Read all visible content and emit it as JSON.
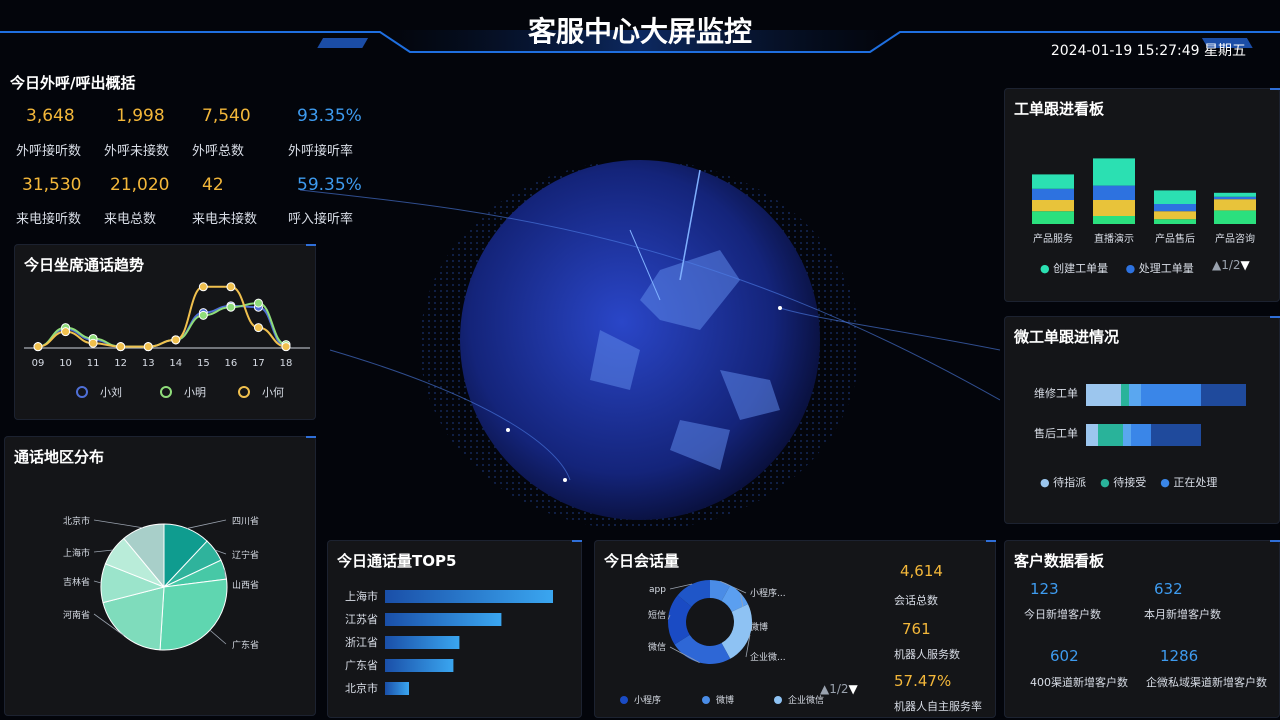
{
  "header": {
    "title": "客服中心大屏监控",
    "datetime": "2024-01-19 15:27:49 星期五"
  },
  "overview": {
    "title": "今日外呼/呼出概括",
    "stats": [
      {
        "value": "3,648",
        "label": "外呼接听数",
        "color": "#f3b73a"
      },
      {
        "value": "1,998",
        "label": "外呼未接数",
        "color": "#f3b73a"
      },
      {
        "value": "7,540",
        "label": "外呼总数",
        "color": "#f3b73a"
      },
      {
        "value": "93.35%",
        "label": "外呼接听率",
        "color": "#3e9bef"
      },
      {
        "value": "31,530",
        "label": "来电接听数",
        "color": "#f3b73a"
      },
      {
        "value": "21,020",
        "label": "来电总数",
        "color": "#f3b73a"
      },
      {
        "value": "42",
        "label": "来电未接数",
        "color": "#f3b73a"
      },
      {
        "value": "59.35%",
        "label": "呼入接听率",
        "color": "#3e9bef"
      }
    ]
  },
  "trend": {
    "title": "今日坐席通话趋势",
    "legend": [
      {
        "name": "小刘",
        "color": "#4f6fd6"
      },
      {
        "name": "小明",
        "color": "#8fdc7a"
      },
      {
        "name": "小何",
        "color": "#f0c04e"
      }
    ]
  },
  "region": {
    "title": "通话地区分布"
  },
  "top5": {
    "title": "今日通话量TOP5"
  },
  "sessions": {
    "title": "今日会话量",
    "pager": "1/2",
    "stats": [
      {
        "value": "4,614",
        "label": "会话总数"
      },
      {
        "value": "761",
        "label": "机器人服务数"
      },
      {
        "value": "57.47%",
        "label": "机器人自主服务率"
      }
    ]
  },
  "customers": {
    "title": "客户数据看板",
    "stats": [
      {
        "value": "123",
        "label": "今日新增客户数"
      },
      {
        "value": "632",
        "label": "本月新增客户数"
      },
      {
        "value": "602",
        "label": "400渠道新增客户数"
      },
      {
        "value": "1286",
        "label": "企微私域渠道新增客户数"
      }
    ]
  },
  "tickets": {
    "title": "工单跟进看板",
    "pager": "1/2",
    "legend": [
      {
        "name": "创建工单量",
        "color": "#2be0b2"
      },
      {
        "name": "处理工单量",
        "color": "#2d72e0"
      }
    ]
  },
  "micro": {
    "title": "微工单跟进情况",
    "legend": [
      {
        "name": "待指派",
        "color": "#9cc6ee"
      },
      {
        "name": "待接受",
        "color": "#29b39a"
      },
      {
        "name": "正在处理",
        "color": "#3a86e8"
      }
    ]
  },
  "chart_data": [
    {
      "type": "line",
      "id": "trend",
      "title": "今日坐席通话趋势",
      "x": [
        "09",
        "10",
        "11",
        "12",
        "13",
        "14",
        "15",
        "16",
        "17",
        "18"
      ],
      "ylim": [
        0,
        100
      ],
      "series": [
        {
          "name": "小刘",
          "color": "#4f6fd6",
          "values": [
            2,
            28,
            12,
            2,
            2,
            12,
            52,
            62,
            60,
            2
          ]
        },
        {
          "name": "小明",
          "color": "#8fdc7a",
          "values": [
            2,
            30,
            14,
            2,
            2,
            12,
            48,
            60,
            66,
            5
          ]
        },
        {
          "name": "小何",
          "color": "#f0c04e",
          "values": [
            2,
            24,
            7,
            2,
            2,
            12,
            90,
            90,
            30,
            2
          ]
        }
      ]
    },
    {
      "type": "pie",
      "id": "region",
      "title": "通话地区分布",
      "slices": [
        {
          "label": "四川省",
          "value": 12,
          "color": "#0f9c8f"
        },
        {
          "label": "辽宁省",
          "value": 6,
          "color": "#2fb39c"
        },
        {
          "label": "山西省",
          "value": 5,
          "color": "#47c8a6"
        },
        {
          "label": "广东省",
          "value": 28,
          "color": "#5fd6b0"
        },
        {
          "label": "河南省",
          "value": 20,
          "color": "#7fdcbc"
        },
        {
          "label": "吉林省",
          "value": 10,
          "color": "#9be4cb"
        },
        {
          "label": "上海市",
          "value": 8,
          "color": "#b9ecd9"
        },
        {
          "label": "北京市",
          "value": 11,
          "color": "#a8cfc9"
        }
      ]
    },
    {
      "type": "bar",
      "id": "top5",
      "title": "今日通话量TOP5",
      "categories": [
        "上海市",
        "江苏省",
        "浙江省",
        "广东省",
        "北京市"
      ],
      "values": [
        140,
        97,
        62,
        57,
        20
      ],
      "xlim": [
        0,
        150
      ]
    },
    {
      "type": "pie",
      "id": "sessions",
      "title": "今日会话量",
      "slices": [
        {
          "label": "小程序...",
          "value": 8,
          "color": "#4a8ce6"
        },
        {
          "label": "微博",
          "value": 10,
          "color": "#5b9ff0"
        },
        {
          "label": "企业微...",
          "value": 24,
          "color": "#8ec2f3"
        },
        {
          "label": "微信",
          "value": 24,
          "color": "#2e67d6"
        },
        {
          "label": "短信",
          "value": 20,
          "color": "#1a4bc4"
        },
        {
          "label": "app",
          "value": 14,
          "color": "#1f56c8"
        }
      ],
      "legend": [
        "小程序",
        "微博",
        "企业微信"
      ]
    },
    {
      "type": "bar",
      "id": "tickets",
      "title": "工单跟进看板",
      "categories": [
        "产品服务",
        "直播演示",
        "产品售后",
        "产品咨询"
      ],
      "series": [
        {
          "name": "seg1",
          "color": "#2be07e",
          "values": [
            16,
            10,
            6,
            17
          ]
        },
        {
          "name": "seg2",
          "color": "#e8c33a",
          "values": [
            14,
            20,
            10,
            14
          ]
        },
        {
          "name": "seg3",
          "color": "#2d72e0",
          "values": [
            14,
            18,
            9,
            3
          ]
        },
        {
          "name": "seg4",
          "color": "#2be0b2",
          "values": [
            18,
            34,
            17,
            5
          ]
        }
      ]
    },
    {
      "type": "bar",
      "id": "micro",
      "title": "微工单跟进情况",
      "categories": [
        "维修工单",
        "售后工单"
      ],
      "series": [
        {
          "name": "待指派",
          "color": "#9cc6ee",
          "values": [
            35,
            12
          ]
        },
        {
          "name": "待接受",
          "color": "#29b39a",
          "values": [
            8,
            25
          ]
        },
        {
          "name": "s3",
          "color": "#5aa7f0",
          "values": [
            12,
            8
          ]
        },
        {
          "name": "正在处理",
          "color": "#3a86e8",
          "values": [
            60,
            20
          ]
        },
        {
          "name": "s5",
          "color": "#1f4a9c",
          "values": [
            45,
            50
          ]
        }
      ]
    }
  ]
}
